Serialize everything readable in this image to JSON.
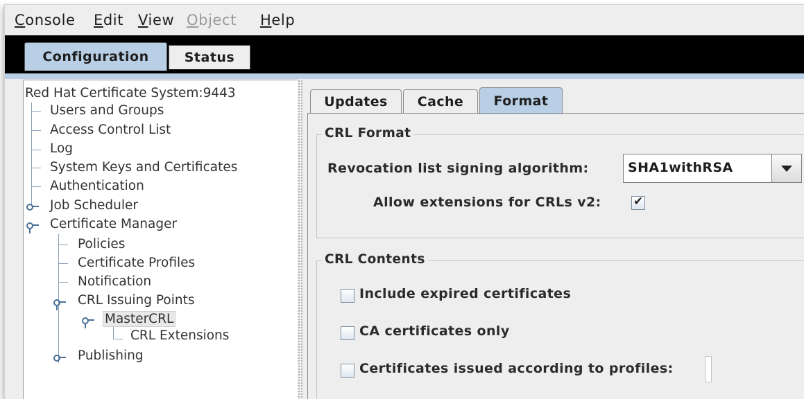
{
  "menubar": {
    "items": [
      "Console",
      "Edit",
      "View",
      "Object",
      "Help"
    ]
  },
  "main_tabs": [
    "Configuration",
    "Status"
  ],
  "tree": {
    "root": "Red Hat Certificate System:9443",
    "items": [
      "Users and Groups",
      "Access Control List",
      "Log",
      "System Keys and Certificates",
      "Authentication",
      "Job Scheduler",
      "Certificate Manager",
      "Policies",
      "Certificate Profiles",
      "Notification",
      "CRL Issuing Points",
      "MasterCRL",
      "CRL Extensions",
      "Publishing"
    ]
  },
  "inner_tabs": [
    "Updates",
    "Cache",
    "Format"
  ],
  "crl_format": {
    "legend": "CRL Format",
    "algo_label": "Revocation list signing algorithm:",
    "algo_value": "SHA1withRSA",
    "ext_label": "Allow extensions for CRLs v2:",
    "ext_checked": true,
    "check_glyph": "✔"
  },
  "crl_contents": {
    "legend": "CRL Contents",
    "options": [
      "Include expired certificates",
      "CA certificates only",
      "Certificates issued according to profiles:"
    ]
  }
}
